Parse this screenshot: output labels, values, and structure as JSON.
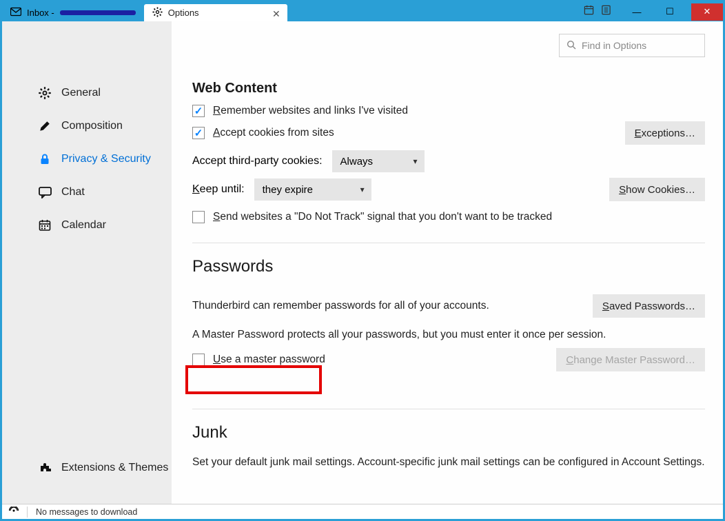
{
  "tabs": {
    "inbox_prefix": "Inbox - ",
    "options": "Options"
  },
  "search": {
    "placeholder": "Find in Options"
  },
  "sidebar": {
    "general": "General",
    "composition": "Composition",
    "privacy": "Privacy & Security",
    "chat": "Chat",
    "calendar": "Calendar",
    "extensions": "Extensions & Themes"
  },
  "webcontent": {
    "heading": "Web Content",
    "remember": "Remember websites and links I've visited",
    "accept_cookies": "Accept cookies from sites",
    "exceptions_btn": "Exceptions…",
    "third_party_label": "Accept third-party cookies:",
    "third_party_value": "Always",
    "keep_until_label": "Keep until:",
    "keep_until_value": "they expire",
    "show_cookies_btn": "Show Cookies…",
    "dnt": "Send websites a \"Do Not Track\" signal that you don't want to be tracked"
  },
  "passwords": {
    "heading": "Passwords",
    "desc": "Thunderbird can remember passwords for all of your accounts.",
    "saved_btn": "Saved Passwords…",
    "master_desc": "A Master Password protects all your passwords, but you must enter it once per session.",
    "use_master": "Use a master password",
    "change_btn": "Change Master Password…"
  },
  "junk": {
    "heading": "Junk",
    "desc": "Set your default junk mail settings. Account-specific junk mail settings can be configured in Account Settings."
  },
  "status": {
    "msg": "No messages to download"
  }
}
